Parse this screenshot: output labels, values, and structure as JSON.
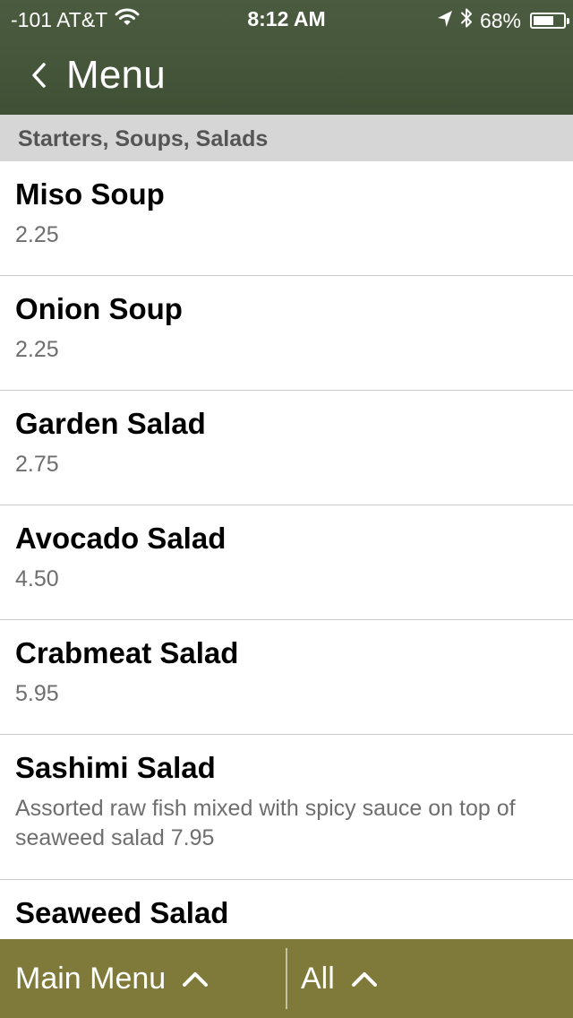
{
  "status_bar": {
    "carrier": "-101 AT&T",
    "time": "8:12 AM",
    "battery": "68%",
    "battery_level": 0.68,
    "icons": [
      "wifi-icon",
      "location-arrow-icon",
      "bluetooth-icon",
      "battery-icon"
    ]
  },
  "nav": {
    "back_icon": "chevron-left-icon",
    "title": "Menu"
  },
  "section": {
    "title": "Starters, Soups, Salads"
  },
  "items": [
    {
      "name": "Miso Soup",
      "detail": "2.25"
    },
    {
      "name": "Onion Soup",
      "detail": "2.25"
    },
    {
      "name": "Garden Salad",
      "detail": "2.75"
    },
    {
      "name": "Avocado Salad",
      "detail": "4.50"
    },
    {
      "name": "Crabmeat Salad",
      "detail": "5.95"
    },
    {
      "name": "Sashimi Salad",
      "detail": "Assorted raw fish mixed with spicy sauce on top of seaweed salad 7.95"
    },
    {
      "name": "Seaweed Salad",
      "detail": ""
    }
  ],
  "toolbar": {
    "main_menu_label": "Main Menu",
    "filter_label": "All",
    "toggle_icon": "chevron-up-icon"
  },
  "colors": {
    "header_bg": "#46563a",
    "toolbar_bg": "#7f7a3a",
    "section_bg": "#d6d6d6",
    "detail_text": "#6e6e6e",
    "separator": "#c9c9c9"
  }
}
